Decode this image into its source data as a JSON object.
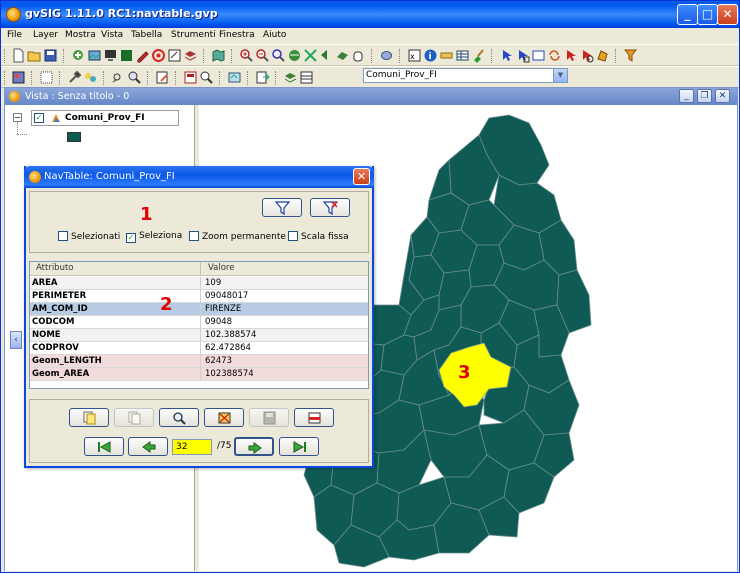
{
  "window": {
    "title": "gvSIG 1.11.0 RC1:navtable.gvp"
  },
  "menu": [
    "File",
    "Layer",
    "Mostra",
    "Vista",
    "Tabella",
    "Strumenti",
    "Finestra",
    "Aiuto"
  ],
  "layer_combo": {
    "value": "Comuni_Prov_FI"
  },
  "vista": {
    "title": "Vista : Senza titolo - 0"
  },
  "toc": {
    "layer_name": "Comuni_Prov_FI",
    "swatch_color": "#0f5a55"
  },
  "navtable": {
    "title": "NavTable: Comuni_Prov_FI",
    "checks": [
      {
        "label": "Selezionati",
        "checked": false
      },
      {
        "label": "Seleziona",
        "checked": true
      },
      {
        "label": "Zoom permanente",
        "checked": false
      },
      {
        "label": "Scala fissa",
        "checked": false
      }
    ],
    "columns": {
      "attr": "Attributo",
      "value": "Valore"
    },
    "rows": [
      {
        "key": "AREA",
        "value": "109"
      },
      {
        "key": "PERIMETER",
        "value": "09048017"
      },
      {
        "key": "AM_COM_ID",
        "value": "FIRENZE"
      },
      {
        "key": "CODCOM",
        "value": "09048"
      },
      {
        "key": "NOME",
        "value": "102.388574"
      },
      {
        "key": "CODPROV",
        "value": "62.472864"
      },
      {
        "key": "Geom_LENGTH",
        "value": "62473"
      },
      {
        "key": "Geom_AREA",
        "value": "102388574"
      }
    ],
    "record": {
      "current": "32",
      "total": "/75"
    }
  },
  "labels": {
    "one": "1",
    "two": "2",
    "three": "3"
  },
  "colors": {
    "region": "#0f5a55",
    "selected": "#ffff00",
    "border": "#6b8f8b"
  }
}
